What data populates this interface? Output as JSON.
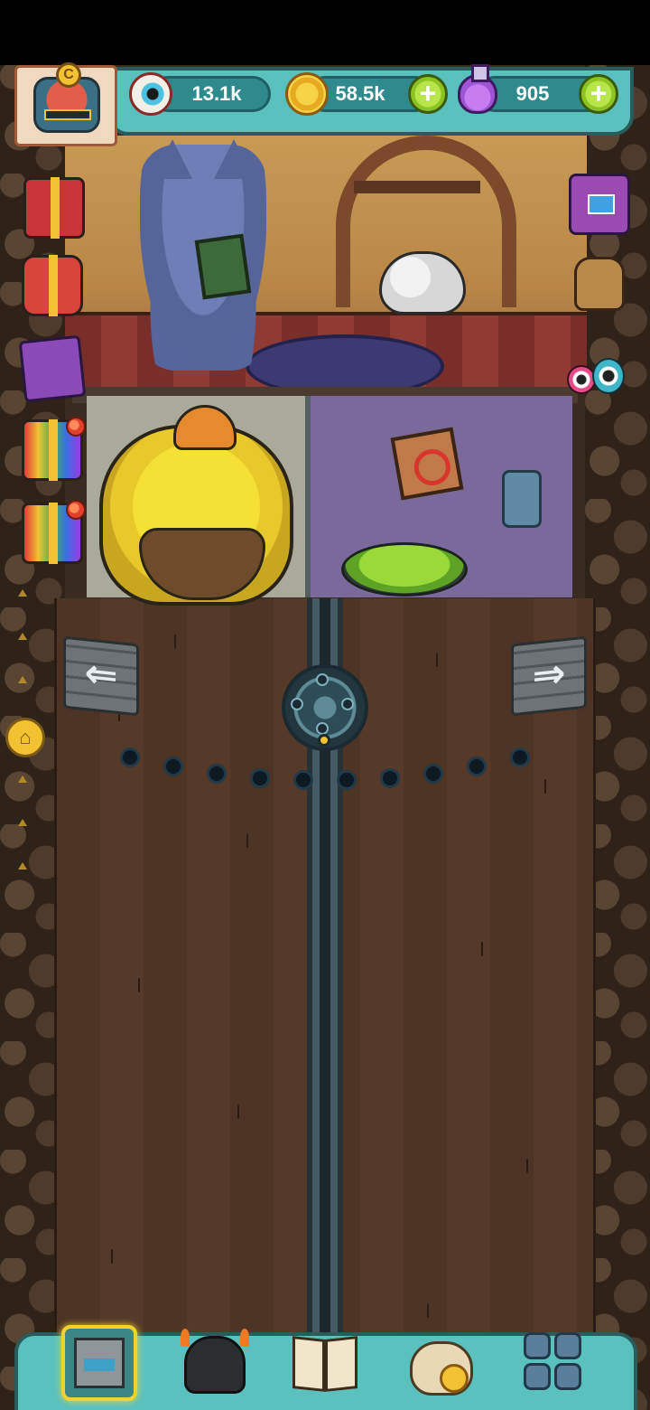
{
  "hud": {
    "eyeballs": "13.1k",
    "coins": "58.5k",
    "potions": "905",
    "avatar_badge": "C",
    "plus": "+"
  },
  "nav": {
    "left_arrow": "⇐",
    "right_arrow": "⇒",
    "home": "⌂"
  },
  "bottom_nav": [
    "base",
    "monsters",
    "book",
    "shop-bag",
    "menu"
  ],
  "colors": {
    "hud_teal": "#5ac1bf",
    "hud_border": "#2a5c5c",
    "plus_green": "#8bc322",
    "highlight_yellow": "#f2d230",
    "dirt_brown": "#4d3425"
  }
}
